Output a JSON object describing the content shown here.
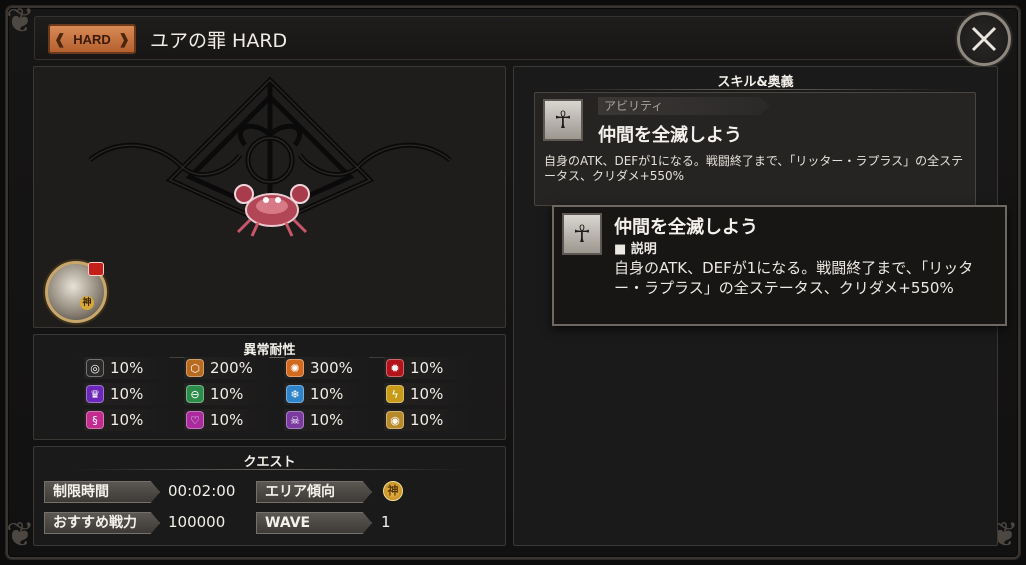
{
  "header": {
    "difficulty_badge": "HARD",
    "title": "ユアの罪 HARD"
  },
  "colors": {
    "background": "#0d0c0c",
    "panel": "#1b1a1a",
    "badge": "#c8713e",
    "border": "#3b3733"
  },
  "resistance": {
    "title": "異常耐性",
    "items": [
      {
        "icon": "swirl-icon",
        "color": "#2a2a2a",
        "glyph": "◎",
        "value": "10%"
      },
      {
        "icon": "shield-icon",
        "color": "#b86a1e",
        "glyph": "⬡",
        "value": "200%"
      },
      {
        "icon": "flame-spiral-icon",
        "color": "#d16a1f",
        "glyph": "✺",
        "value": "300%"
      },
      {
        "icon": "blast-icon",
        "color": "#b3141b",
        "glyph": "✹",
        "value": "10%"
      },
      {
        "icon": "crown-icon",
        "color": "#6a27b8",
        "glyph": "♛",
        "value": "10%"
      },
      {
        "icon": "chain-icon",
        "color": "#2c8c49",
        "glyph": "⊖",
        "value": "10%"
      },
      {
        "icon": "snowflake-icon",
        "color": "#2f83c9",
        "glyph": "❄",
        "value": "10%"
      },
      {
        "icon": "lightning-icon",
        "color": "#c79a18",
        "glyph": "ϟ",
        "value": "10%"
      },
      {
        "icon": "dna-icon",
        "color": "#c22c8e",
        "glyph": "§",
        "value": "10%"
      },
      {
        "icon": "heart-swirl-icon",
        "color": "#a92b9e",
        "glyph": "♡",
        "value": "10%"
      },
      {
        "icon": "skull-icon",
        "color": "#7a3aa0",
        "glyph": "☠",
        "value": "10%"
      },
      {
        "icon": "spiral-eye-icon",
        "color": "#b88a2a",
        "glyph": "◉",
        "value": "10%"
      }
    ]
  },
  "quest": {
    "title": "クエスト",
    "time_limit_label": "制限時間",
    "time_limit_value": "00:02:00",
    "area_label": "エリア傾向",
    "area_value_icon": "element-god-icon",
    "area_value_glyph": "神",
    "recommended_label": "おすすめ戦力",
    "recommended_value": "100000",
    "wave_label": "WAVE",
    "wave_value": "1"
  },
  "skills": {
    "title": "スキル&奥義",
    "card": {
      "tag": "アビリティ",
      "name": "仲間を全滅しよう",
      "description": "自身のATK、DEFが1になる。戦闘終了まで、「リッター・ラプラス」の全ステータス、クリダメ+550%"
    },
    "tooltip": {
      "name": "仲間を全滅しよう",
      "section": "■ 説明",
      "description": "自身のATK、DEFが1になる。戦闘終了まで、「リッター・ラプラス」の全ステータス、クリダメ+550%"
    }
  },
  "avatar": {
    "element_glyph": "神"
  }
}
